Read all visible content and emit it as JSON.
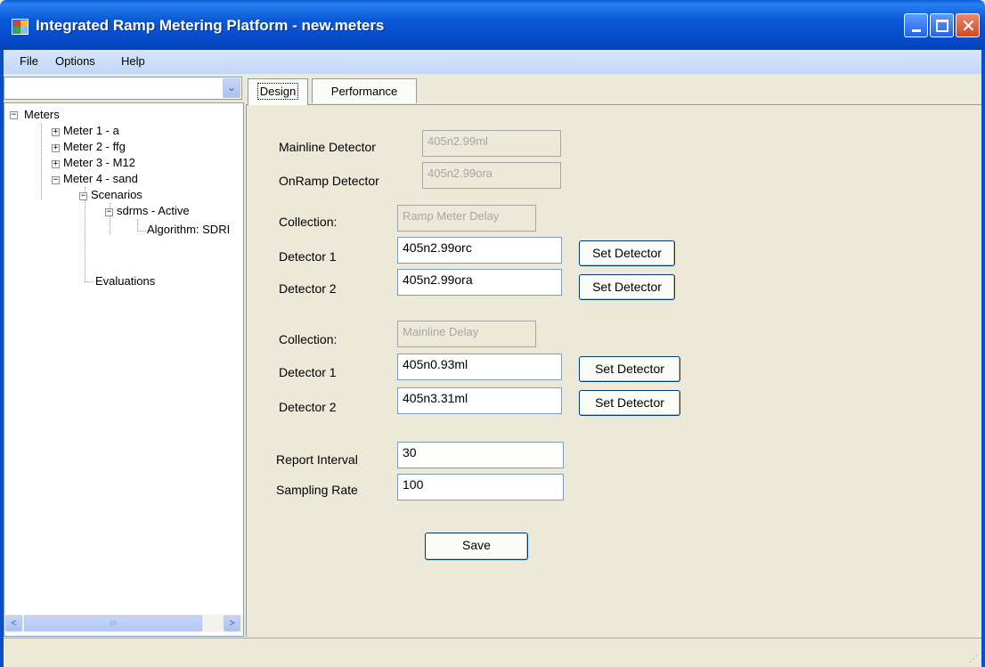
{
  "window": {
    "title": "Integrated Ramp Metering Platform - new.meters",
    "minimize_icon": "minimize-icon",
    "maximize_icon": "maximize-icon",
    "close_icon": "close-icon"
  },
  "menu": {
    "items": [
      {
        "label": "File"
      },
      {
        "label": "Options"
      },
      {
        "label": "Help"
      }
    ]
  },
  "sidebar": {
    "combo_value": "",
    "tree": {
      "root": "Meters",
      "meter1": "Meter 1 - a",
      "meter2": "Meter 2 - ffg",
      "meter3": "Meter 3 - M12",
      "meter4": "Meter 4 - sand",
      "scenarios": "Scenarios",
      "scenario": "sdrms - Active",
      "algorithm": "Algorithm: SDRI",
      "evaluations": "Evaluations"
    },
    "expand_glyph": "+",
    "collapse_glyph": "−",
    "scroll_left": "<",
    "scroll_right": ">",
    "scroll_grip": "III"
  },
  "tabs": [
    {
      "label": "Design",
      "selected": true
    },
    {
      "label": "Performance",
      "selected": false
    }
  ],
  "design": {
    "mainline_label": "Mainline Detector",
    "mainline_value": "405n2.99ml",
    "onramp_label": "OnRamp Detector",
    "onramp_value": "405n2.99ora",
    "group1": {
      "collection_label": "Collection:",
      "collection_value": "Ramp Meter Delay",
      "det1_label": "Detector 1",
      "det1_value": "405n2.99orc",
      "det2_label": "Detector 2",
      "det2_value": "405n2.99ora"
    },
    "group2": {
      "collection_label": "Collection:",
      "collection_value": "Mainline Delay",
      "det1_label": "Detector 1",
      "det1_value": "405n0.93ml",
      "det2_label": "Detector 2",
      "det2_value": "405n3.31ml"
    },
    "set_detector_label": "Set Detector",
    "report_label": "Report Interval",
    "report_value": "30",
    "sampling_label": "Sampling Rate",
    "sampling_value": "100",
    "save_label": "Save"
  },
  "colors": {
    "titlebar": "#0a58d8",
    "menubar": "#c1d8f7",
    "body": "#ece9d8"
  }
}
